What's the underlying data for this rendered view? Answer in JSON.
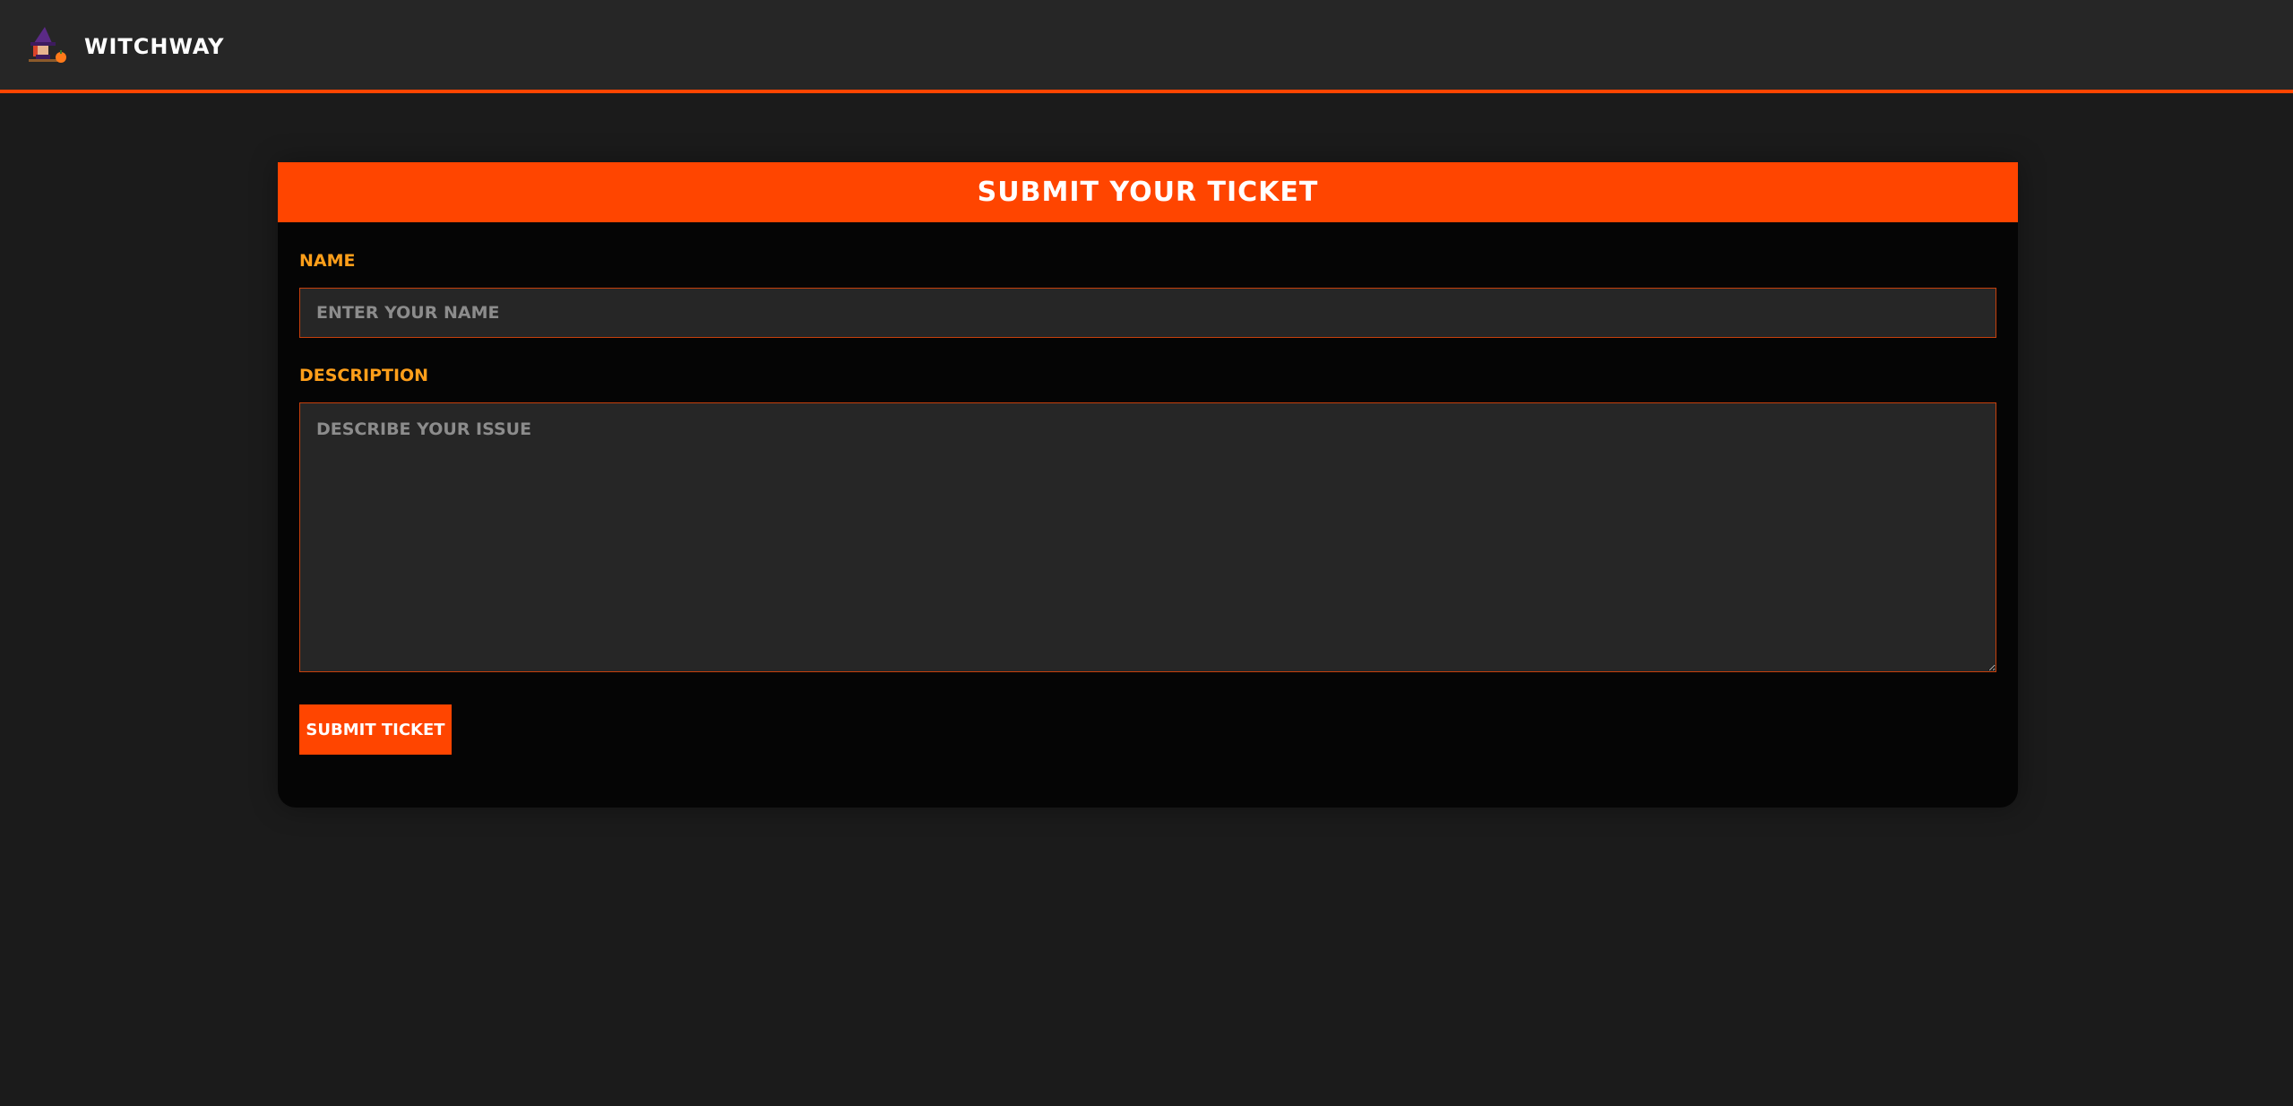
{
  "navbar": {
    "brand": "WITCHWAY",
    "logo_icon": "witch-on-broom-icon",
    "accent": "#ff4500"
  },
  "form": {
    "title": "SUBMIT YOUR TICKET",
    "name_label": "NAME",
    "name_placeholder": "ENTER YOUR NAME",
    "description_label": "DESCRIPTION",
    "description_placeholder": "DESCRIBE YOUR ISSUE",
    "submit_label": "SUBMIT TICKET"
  },
  "colors": {
    "accent": "#ff4500",
    "label": "#ff9f1a",
    "background": "#1b1b1b",
    "card": "#050505",
    "input_bg": "#262626"
  }
}
